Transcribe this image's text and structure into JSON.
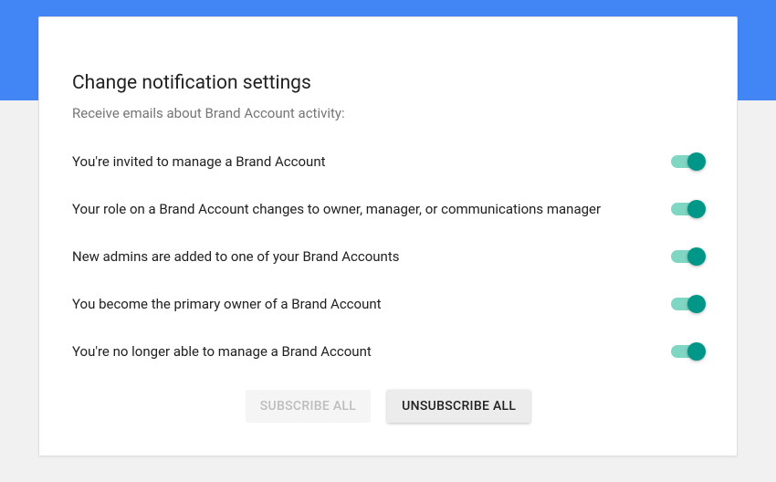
{
  "header": {
    "title": "Change notification settings",
    "subtitle": "Receive emails about Brand Account activity:"
  },
  "notifications": [
    {
      "label": "You're invited to manage a Brand Account",
      "on": true
    },
    {
      "label": "Your role on a Brand Account changes to owner, manager, or communications manager",
      "on": true
    },
    {
      "label": "New admins are added to one of your Brand Accounts",
      "on": true
    },
    {
      "label": "You become the primary owner of a Brand Account",
      "on": true
    },
    {
      "label": "You're no longer able to manage a Brand Account",
      "on": true
    }
  ],
  "buttons": {
    "subscribe_all": "SUBSCRIBE ALL",
    "unsubscribe_all": "UNSUBSCRIBE ALL"
  },
  "colors": {
    "accent": "#4285f4",
    "toggle_on": "#009688"
  }
}
